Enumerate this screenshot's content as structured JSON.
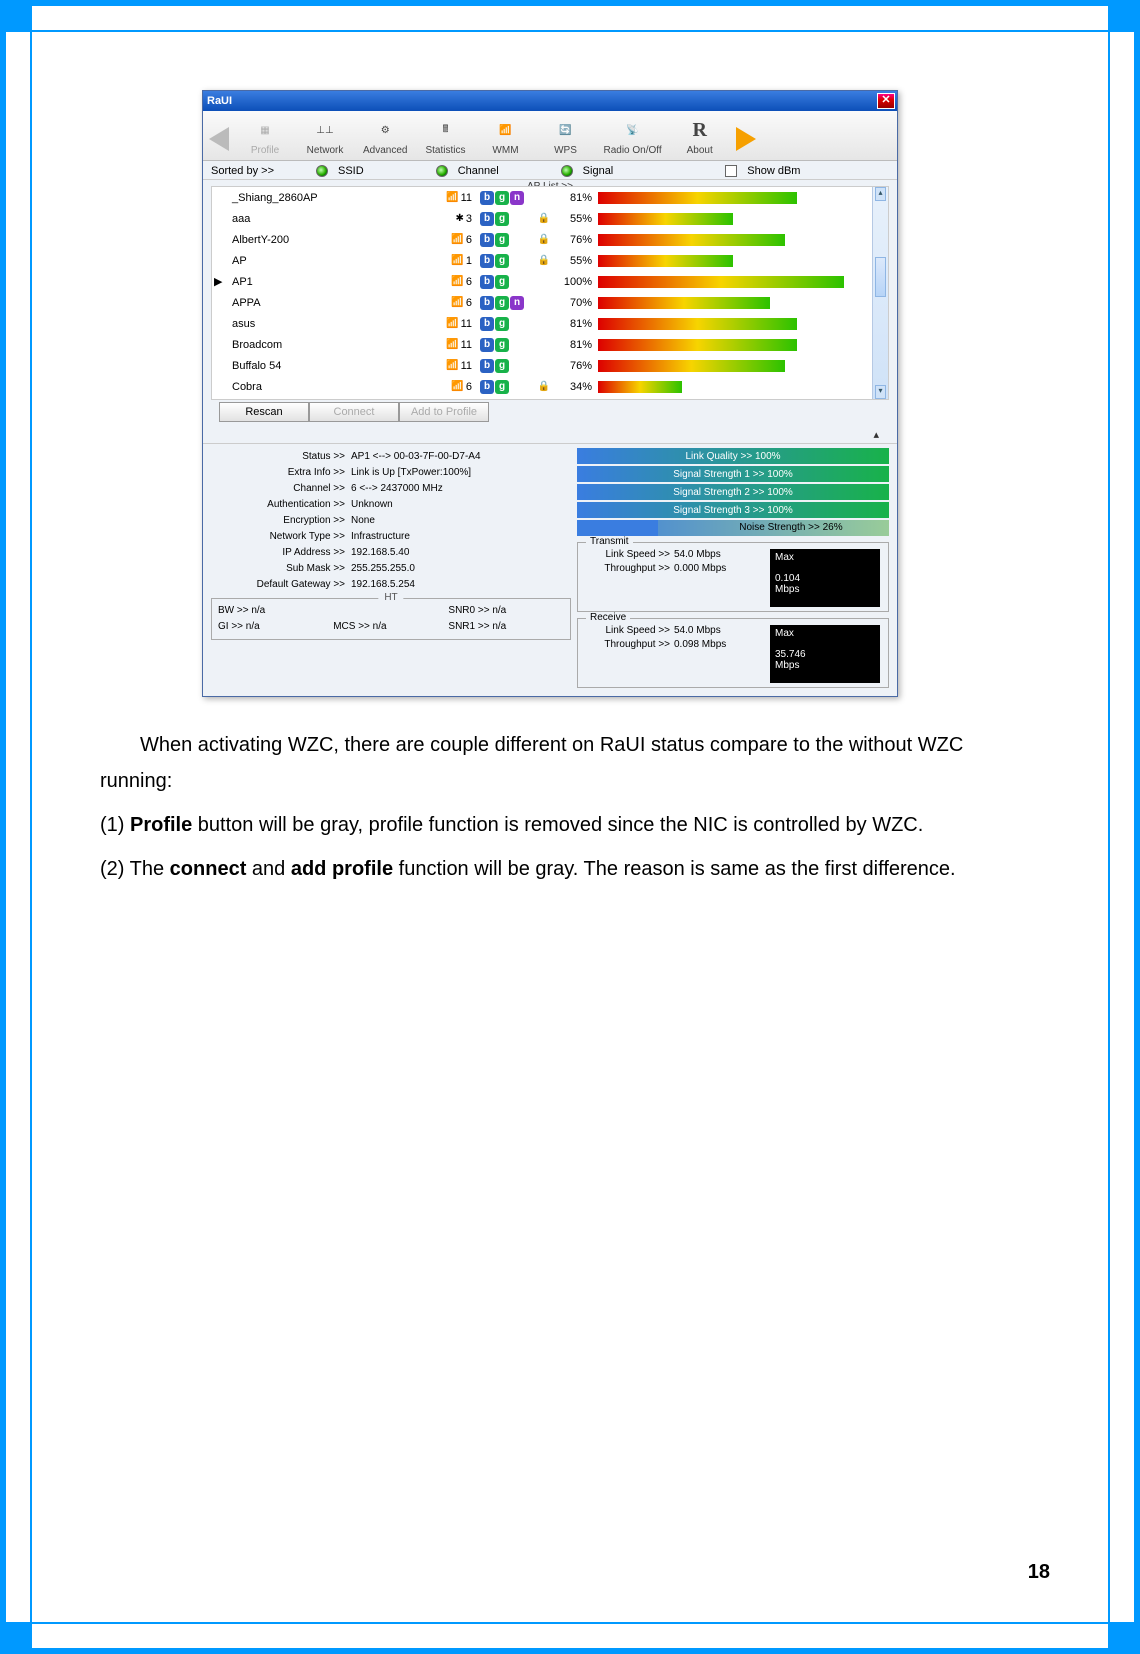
{
  "window": {
    "title": "RaUI",
    "toolbar": {
      "profile": "Profile",
      "network": "Network",
      "advanced": "Advanced",
      "statistics": "Statistics",
      "wmm": "WMM",
      "wps": "WPS",
      "radio": "Radio On/Off",
      "about": "About"
    },
    "sortbar": {
      "sorted_by": "Sorted by >>",
      "ssid": "SSID",
      "channel": "Channel",
      "signal": "Signal",
      "show_dbm": "Show dBm",
      "ap_list": "AP List >>"
    },
    "ap_rows": [
      {
        "ssid": "_Shiang_2860AP",
        "channel": "11",
        "modes": [
          "b",
          "g",
          "n"
        ],
        "lock": false,
        "pct": "81%",
        "pctv": 81,
        "sel": false,
        "ch_icon": "signal"
      },
      {
        "ssid": "aaa",
        "channel": "3",
        "modes": [
          "b",
          "g"
        ],
        "lock": true,
        "pct": "55%",
        "pctv": 55,
        "sel": false,
        "ch_icon": "fan"
      },
      {
        "ssid": "AlbertY-200",
        "channel": "6",
        "modes": [
          "b",
          "g"
        ],
        "lock": true,
        "pct": "76%",
        "pctv": 76,
        "sel": false,
        "ch_icon": "signal"
      },
      {
        "ssid": "AP",
        "channel": "1",
        "modes": [
          "b",
          "g"
        ],
        "lock": true,
        "pct": "55%",
        "pctv": 55,
        "sel": false,
        "ch_icon": "signal"
      },
      {
        "ssid": "AP1",
        "channel": "6",
        "modes": [
          "b",
          "g"
        ],
        "lock": false,
        "pct": "100%",
        "pctv": 100,
        "sel": true,
        "ch_icon": "signal"
      },
      {
        "ssid": "APPA",
        "channel": "6",
        "modes": [
          "b",
          "g",
          "n"
        ],
        "lock": false,
        "pct": "70%",
        "pctv": 70,
        "sel": false,
        "ch_icon": "signal"
      },
      {
        "ssid": "asus",
        "channel": "11",
        "modes": [
          "b",
          "g"
        ],
        "lock": false,
        "pct": "81%",
        "pctv": 81,
        "sel": false,
        "ch_icon": "signal"
      },
      {
        "ssid": "Broadcom",
        "channel": "11",
        "modes": [
          "b",
          "g"
        ],
        "lock": false,
        "pct": "81%",
        "pctv": 81,
        "sel": false,
        "ch_icon": "signal"
      },
      {
        "ssid": "Buffalo 54",
        "channel": "11",
        "modes": [
          "b",
          "g"
        ],
        "lock": false,
        "pct": "76%",
        "pctv": 76,
        "sel": false,
        "ch_icon": "signal"
      },
      {
        "ssid": "Cobra",
        "channel": "6",
        "modes": [
          "b",
          "g"
        ],
        "lock": true,
        "pct": "34%",
        "pctv": 34,
        "sel": false,
        "ch_icon": "signal"
      }
    ],
    "buttons": {
      "rescan": "Rescan",
      "connect": "Connect",
      "add_profile": "Add to Profile"
    },
    "status": {
      "rows": [
        {
          "label": "Status >>",
          "value": "AP1 <--> 00-03-7F-00-D7-A4"
        },
        {
          "label": "Extra Info >>",
          "value": "Link is Up [TxPower:100%]"
        },
        {
          "label": "Channel >>",
          "value": "6 <--> 2437000 MHz"
        },
        {
          "label": "Authentication >>",
          "value": "Unknown"
        },
        {
          "label": "Encryption >>",
          "value": "None"
        },
        {
          "label": "Network Type >>",
          "value": "Infrastructure"
        },
        {
          "label": "IP Address >>",
          "value": "192.168.5.40"
        },
        {
          "label": "Sub Mask >>",
          "value": "255.255.255.0"
        },
        {
          "label": "Default Gateway >>",
          "value": "192.168.5.254"
        }
      ],
      "ht_legend": "HT",
      "ht": [
        {
          "label": "BW >>",
          "value": "n/a"
        },
        {
          "label": "SNR0 >>",
          "value": "n/a"
        },
        {
          "label": "GI >>",
          "value": "n/a"
        },
        {
          "label": "MCS >>",
          "value": "n/a"
        },
        {
          "label": "SNR1 >>",
          "value": "n/a"
        }
      ],
      "bars": {
        "link_quality": "Link Quality >> 100%",
        "ss1": "Signal Strength 1 >> 100%",
        "ss2": "Signal Strength 2 >> 100%",
        "ss3": "Signal Strength 3 >> 100%",
        "noise_label": "Noise Strength >> 26%",
        "noise_pct": 26
      },
      "transmit": {
        "legend": "Transmit",
        "link_speed_label": "Link Speed >>",
        "link_speed": "54.0 Mbps",
        "throughput_label": "Throughput >>",
        "throughput": "0.000 Mbps",
        "max_label": "Max",
        "max_value": "0.104",
        "max_unit": "Mbps"
      },
      "receive": {
        "legend": "Receive",
        "link_speed_label": "Link Speed >>",
        "link_speed": "54.0 Mbps",
        "throughput_label": "Throughput >>",
        "throughput": "0.098 Mbps",
        "max_label": "Max",
        "max_value": "35.746",
        "max_unit": "Mbps"
      }
    }
  },
  "doc": {
    "para1": "When activating WZC, there are couple different on RaUI status compare to the without WZC running:",
    "item1_pre": "(1) ",
    "item1_bold": "Profile",
    "item1_post": " button will be gray, profile function is removed since the NIC is controlled by WZC.",
    "item2_pre": "(2) The ",
    "item2_bold1": "connect",
    "item2_mid": " and ",
    "item2_bold2": "add profile",
    "item2_post": " function will be gray. The reason is same as the first difference."
  },
  "page_number": "18"
}
